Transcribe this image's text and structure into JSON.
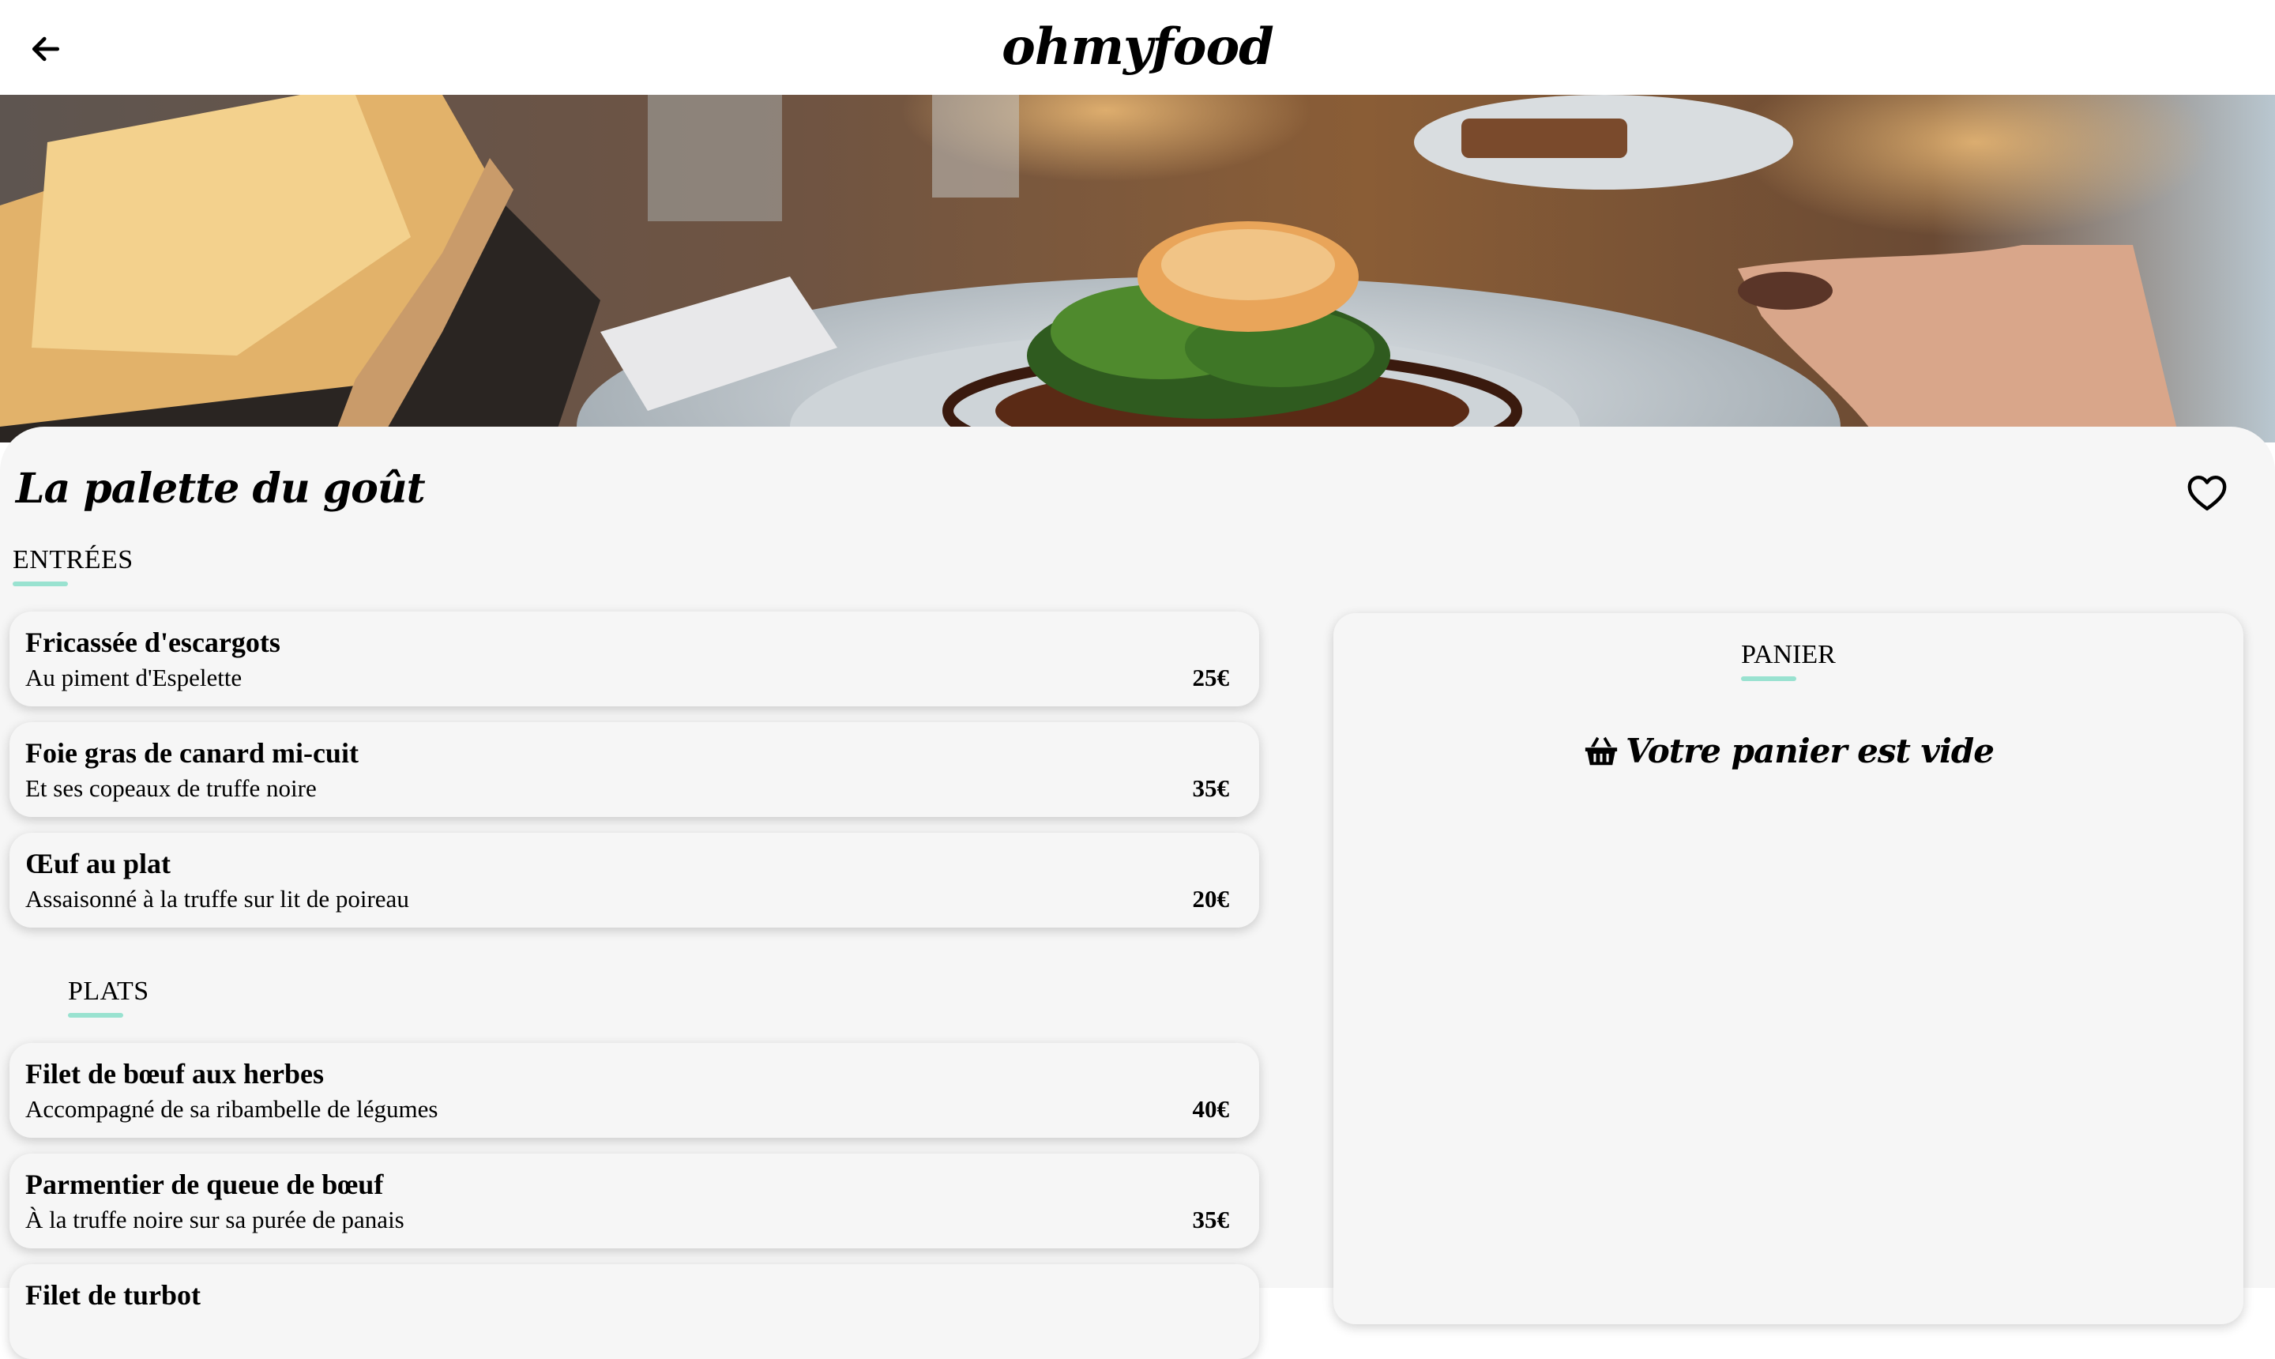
{
  "header": {
    "back_icon": "arrow-left-icon",
    "logo": "ohmyfood"
  },
  "hero": {
    "alt": "restaurant-plated-fish-dish-photo"
  },
  "restaurant": {
    "name": "La palette du goût",
    "favorite_icon": "heart-outline-icon"
  },
  "sections": [
    {
      "title": "ENTRÉES",
      "dishes": [
        {
          "name": "Fricassée d'escargots",
          "description": "Au piment d'Espelette",
          "price": "25€"
        },
        {
          "name": "Foie gras de canard mi-cuit",
          "description": "Et ses copeaux de truffe noire",
          "price": "35€"
        },
        {
          "name": "Œuf au plat",
          "description": "Assaisonné à la truffe sur lit de poireau",
          "price": "20€"
        }
      ]
    },
    {
      "title": "PLATS",
      "dishes": [
        {
          "name": "Filet de bœuf aux herbes",
          "description": "Accompagné de sa ribambelle de légumes",
          "price": "40€"
        },
        {
          "name": "Parmentier de queue de bœuf",
          "description": "À la truffe noire sur sa purée de panais",
          "price": "35€"
        },
        {
          "name": "Filet de turbot",
          "description": "",
          "price": ""
        }
      ]
    }
  ],
  "cart": {
    "title": "PANIER",
    "empty_icon": "basket-icon",
    "empty_text": "Votre panier est vide"
  },
  "colors": {
    "accent": "#99e2d0",
    "card_bg": "#f6f6f6"
  }
}
